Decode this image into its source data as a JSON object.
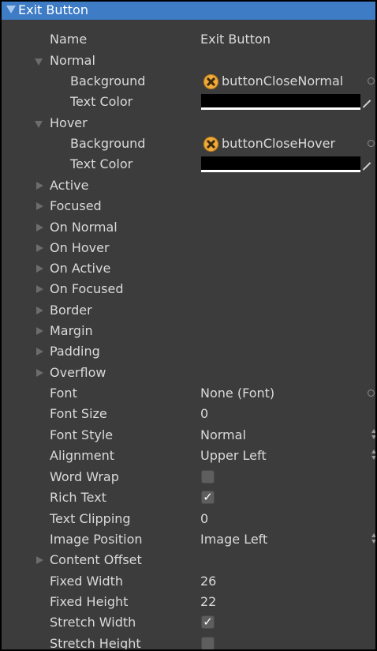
{
  "header": {
    "title": "Exit Button"
  },
  "name_row": {
    "label": "Name",
    "value": "Exit Button"
  },
  "normal": {
    "label": "Normal",
    "background_label": "Background",
    "background_value": "buttonCloseNormal",
    "text_color_label": "Text Color"
  },
  "hover": {
    "label": "Hover",
    "background_label": "Background",
    "background_value": "buttonCloseHover",
    "text_color_label": "Text Color"
  },
  "collapsed": [
    "Active",
    "Focused",
    "On Normal",
    "On Hover",
    "On Active",
    "On Focused",
    "Border",
    "Margin",
    "Padding",
    "Overflow"
  ],
  "font": {
    "label": "Font",
    "value": "None (Font)"
  },
  "font_size": {
    "label": "Font Size",
    "value": "0"
  },
  "font_style": {
    "label": "Font Style",
    "value": "Normal"
  },
  "alignment": {
    "label": "Alignment",
    "value": "Upper Left"
  },
  "word_wrap": {
    "label": "Word Wrap",
    "checked": false
  },
  "rich_text": {
    "label": "Rich Text",
    "checked": true,
    "mark": "✓"
  },
  "text_clipping": {
    "label": "Text Clipping",
    "value": "0"
  },
  "image_position": {
    "label": "Image Position",
    "value": "Image Left"
  },
  "content_offset": {
    "label": "Content Offset"
  },
  "fixed_width": {
    "label": "Fixed Width",
    "value": "26"
  },
  "fixed_height": {
    "label": "Fixed Height",
    "value": "22"
  },
  "stretch_width": {
    "label": "Stretch Width",
    "checked": true,
    "mark": "✓"
  },
  "stretch_height": {
    "label": "Stretch Height",
    "checked": false
  },
  "colors": {
    "panel_bg": "#3c3c3c",
    "header_bg": "#3e7cc6",
    "text": "#dadada",
    "text_color_swatch": "#000000",
    "icon_orange": "#f0a93a"
  },
  "icons": {
    "header_toggle": "triangle-down-icon",
    "foldout_open": "triangle-down-icon",
    "foldout_closed": "triangle-right-icon",
    "texture": "close-x-circle-icon",
    "object_picker": "circle-target-icon",
    "color_picker": "eyedropper-icon",
    "enum_arrows": "up-down-arrows-icon"
  }
}
